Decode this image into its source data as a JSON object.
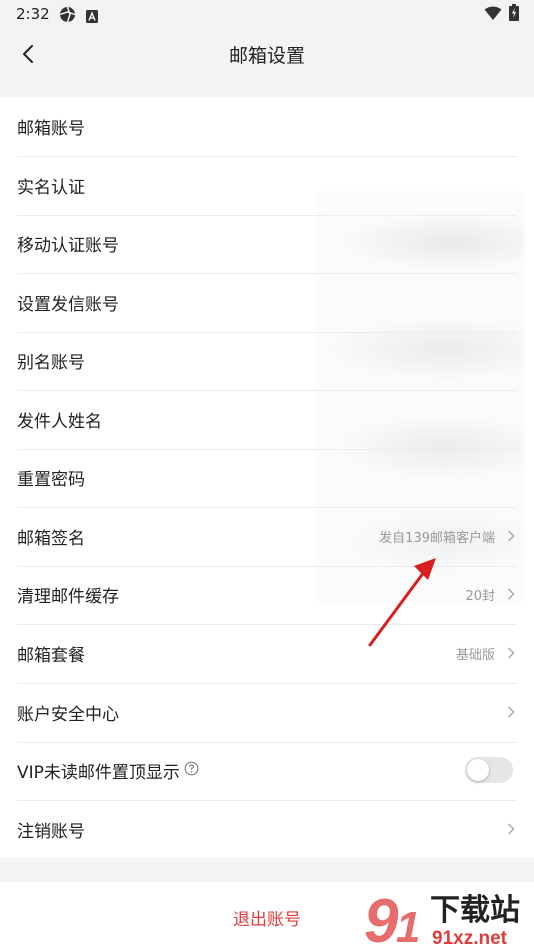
{
  "status_bar": {
    "time": "2:32",
    "icons": [
      "aperture-icon",
      "font-a-icon",
      "wifi-icon",
      "battery-charging-icon"
    ]
  },
  "header": {
    "title": "邮箱设置",
    "back_icon": "chevron-left-icon"
  },
  "settings": [
    {
      "id": "mailbox-account",
      "label": "邮箱账号",
      "value": ""
    },
    {
      "id": "realname-verify",
      "label": "实名认证",
      "value": ""
    },
    {
      "id": "mobile-verify-account",
      "label": "移动认证账号",
      "value": ""
    },
    {
      "id": "sender-account",
      "label": "设置发信账号",
      "value": ""
    },
    {
      "id": "alias-account",
      "label": "别名账号",
      "value": ""
    },
    {
      "id": "sender-name",
      "label": "发件人姓名",
      "value": ""
    },
    {
      "id": "reset-password",
      "label": "重置密码",
      "value": ""
    },
    {
      "id": "mailbox-signature",
      "label": "邮箱签名",
      "value": "发自139邮箱客户端"
    },
    {
      "id": "clear-cache",
      "label": "清理邮件缓存",
      "value": "20封"
    },
    {
      "id": "mailbox-plan",
      "label": "邮箱套餐",
      "value": "基础版"
    },
    {
      "id": "account-security",
      "label": "账户安全中心",
      "value": ""
    },
    {
      "id": "vip-unread-top",
      "label": "VIP未读邮件置顶显示",
      "value": "",
      "toggle": false
    },
    {
      "id": "cancel-account",
      "label": "注销账号",
      "value": ""
    }
  ],
  "footer": {
    "logout_label": "退出账号"
  },
  "watermark": {
    "brand_text": "下载站",
    "domain_text": "91xz.net"
  },
  "colors": {
    "accent_red": "#e03c3c",
    "background": "#f3f3f6",
    "annotation_arrow": "#d81e1e"
  }
}
